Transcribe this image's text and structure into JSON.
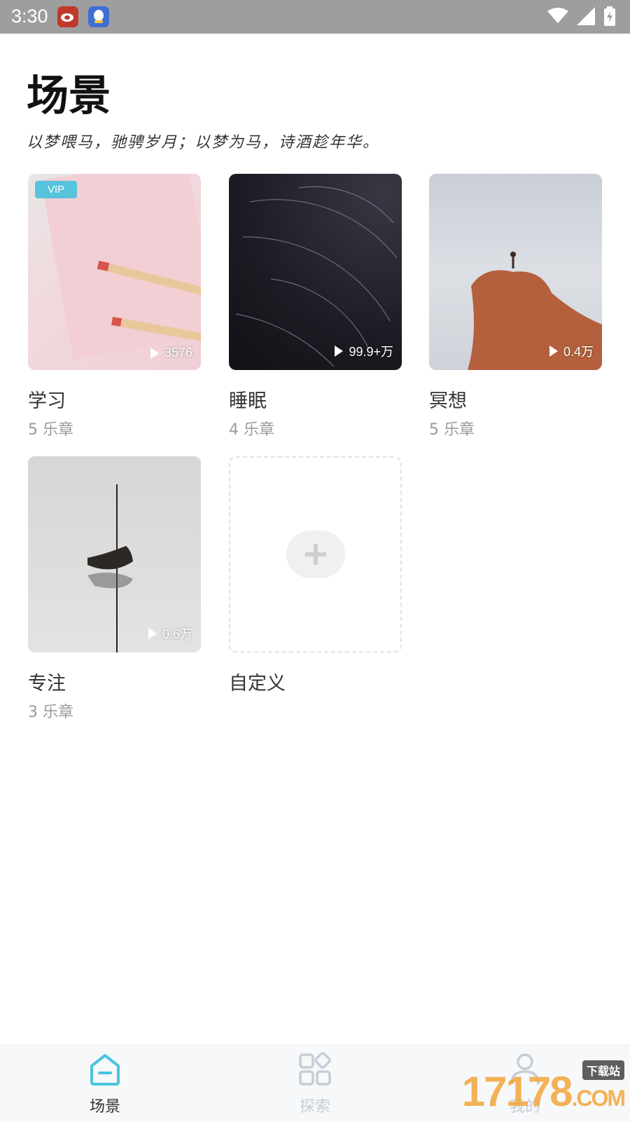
{
  "status_bar": {
    "time": "3:30",
    "icons": [
      "weibo-app-icon",
      "qq-app-icon",
      "wifi-icon",
      "signal-icon",
      "battery-charging-icon"
    ]
  },
  "header": {
    "title": "场景",
    "subtitle": "以梦喂马，驰骋岁月；以梦为马，诗酒趁年华。"
  },
  "scenes": [
    {
      "name": "学习",
      "count": "5 乐章",
      "plays": "3576",
      "badge": "VIP"
    },
    {
      "name": "睡眠",
      "count": "4 乐章",
      "plays": "99.9+万"
    },
    {
      "name": "冥想",
      "count": "5 乐章",
      "plays": "0.4万"
    },
    {
      "name": "专注",
      "count": "3 乐章",
      "plays": "0.6万"
    }
  ],
  "custom": {
    "name": "自定义"
  },
  "bottom_nav": {
    "items": [
      {
        "label": "场景",
        "icon": "home-icon",
        "active": true
      },
      {
        "label": "探索",
        "icon": "grid-icon",
        "active": false
      },
      {
        "label": "我的",
        "icon": "user-icon",
        "active": false
      }
    ],
    "active_color": "#4ac5dc",
    "inactive_color": "#c7ccd6"
  },
  "watermark": {
    "text": "17178",
    "suffix": ".COM",
    "tag": "下载站"
  }
}
